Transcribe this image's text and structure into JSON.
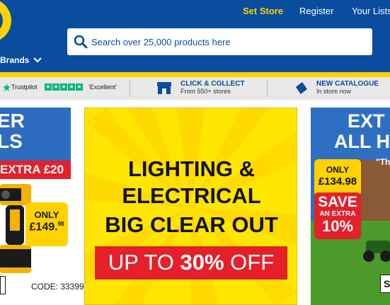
{
  "header": {
    "set_store": "Set Store",
    "register": "Register",
    "your_lists": "Your Lists",
    "brands": "Brands",
    "search_placeholder": "Search over 25,000 products here"
  },
  "trust_bar": {
    "trustpilot": "Trustpilot",
    "rating": "'Excellent'",
    "click_collect_title": "CLICK & COLLECT",
    "click_collect_sub": "From 550+ stores",
    "catalogue_title": "NEW CATALOGUE",
    "catalogue_sub": "In store now"
  },
  "promos": {
    "left": {
      "headline_1": "ER",
      "headline_2": "LS",
      "extra": "EXTRA £20",
      "only": "ONLY",
      "price": "£149.",
      "price_pence": "98",
      "code": "CODE: 33399"
    },
    "center": {
      "line_1": "LIGHTING &",
      "line_2": "ELECTRICAL",
      "line_3": "BIG CLEAR OUT",
      "up_to": "UP TO",
      "percent": "30%",
      "off": "OFF"
    },
    "right": {
      "headline_1": "EXT",
      "headline_2": "ALL H",
      "quote": "\"Th",
      "only": "ONLY",
      "price": "£134.98",
      "save": "SAVE",
      "an_extra": "AN EXTRA",
      "percent": "10%",
      "code_char": "S"
    }
  },
  "colors": {
    "brand_blue": "#0a4c9e",
    "brand_yellow": "#ffd200",
    "promo_red": "#e4202a",
    "trustpilot_green": "#00b67a"
  }
}
